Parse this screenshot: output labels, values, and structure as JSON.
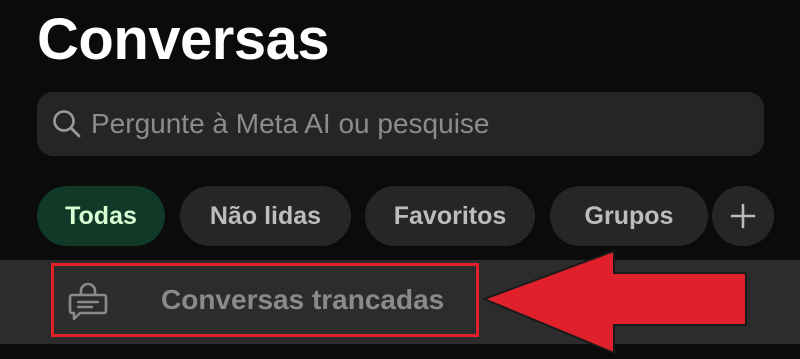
{
  "header": {
    "title": "Conversas"
  },
  "search": {
    "placeholder": "Pergunte à Meta AI ou pesquise",
    "icon": "search-icon"
  },
  "filters": {
    "chips": [
      {
        "label": "Todas",
        "active": true
      },
      {
        "label": "Não lidas",
        "active": false
      },
      {
        "label": "Favoritos",
        "active": false
      },
      {
        "label": "Grupos",
        "active": false
      }
    ],
    "add_icon": "plus-icon"
  },
  "locked_chats": {
    "label": "Conversas trancadas",
    "icon": "locked-chat-icon"
  },
  "annotation": {
    "arrow_color": "#e0202a",
    "box_color": "#e0202a"
  },
  "colors": {
    "background": "#0b0b0b",
    "active_chip_bg": "#103927",
    "active_chip_text": "#d9fdd3",
    "chip_bg": "#262626"
  }
}
